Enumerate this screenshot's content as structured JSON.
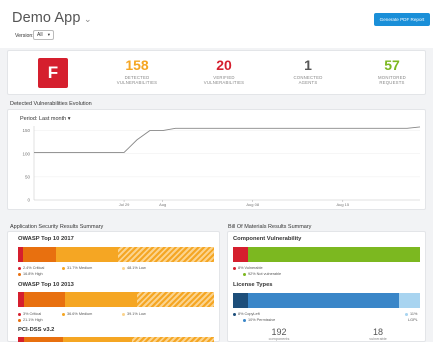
{
  "header": {
    "app_title": "Demo App",
    "generate_button": "Generate PDF Report",
    "version_label": "Version:",
    "version_value": "All"
  },
  "summary": {
    "grade": "F",
    "kpis": [
      {
        "value": "158",
        "label_1": "DETECTED",
        "label_2": "VULNERABILITIES",
        "color": "#f5a623"
      },
      {
        "value": "20",
        "label_1": "VERIFIED",
        "label_2": "VULNERABILITIES",
        "color": "#d51f2e"
      },
      {
        "value": "1",
        "label_1": "CONNECTED",
        "label_2": "AGENTS",
        "color": "#555555"
      },
      {
        "value": "57",
        "label_1": "MONITORED",
        "label_2": "REQUESTS",
        "color": "#7cb820"
      }
    ]
  },
  "evolution": {
    "title": "Detected Vulnerabilities Evolution",
    "period": "Period: Last month"
  },
  "chart_data": {
    "type": "line",
    "title": "",
    "x": [
      "Jul 22",
      "Jul 23",
      "Jul 24",
      "Jul 25",
      "Jul 26",
      "Jul 27",
      "Jul 28",
      "Jul 29",
      "Jul 30",
      "Jul 31",
      "Aug 1",
      "Aug 2",
      "Aug 3",
      "Aug 4",
      "Aug 5",
      "Aug 6",
      "Aug 7",
      "Aug 8",
      "Aug 9",
      "Aug 10",
      "Aug 11",
      "Aug 12",
      "Aug 13",
      "Aug 14",
      "Aug 15",
      "Aug 16",
      "Aug 17",
      "Aug 18",
      "Aug 19",
      "Aug 20",
      "Aug 21"
    ],
    "x_ticks": [
      "Jul 29",
      "Aug",
      "Aug 08",
      "Aug 15"
    ],
    "series": [
      {
        "values": [
          103,
          103,
          103,
          103,
          103,
          103,
          103,
          103,
          130,
          150,
          150,
          155,
          155,
          155,
          155,
          155,
          155,
          155,
          155,
          155,
          155,
          155,
          155,
          155,
          155,
          155,
          155,
          155,
          155,
          155,
          158
        ]
      }
    ],
    "ylim": [
      0,
      160
    ],
    "y_ticks": [
      "0",
      "50",
      "100",
      "150"
    ],
    "grid": true,
    "color": "#888888"
  },
  "app_security": {
    "title": "Application Security Results Summary",
    "groups": [
      {
        "name": "OWASP Top 10 2017",
        "legend": [
          "2.4% Critical",
          "31.7% Medium",
          "48.1% Low",
          "16.8% High"
        ]
      },
      {
        "name": "OWASP Top 10 2013",
        "legend": [
          "3% Critical",
          "36.6% Medium",
          "39.1% Low",
          "21.1% High"
        ]
      },
      {
        "name": "PCI-DSS v3.2",
        "legend": []
      }
    ]
  },
  "bom": {
    "title": "Bill Of Materials Results Summary",
    "component_title": "Component Vulnerability",
    "component_legend": [
      "8% Vulnerable",
      "92% Not vulnerable"
    ],
    "license_title": "License Types",
    "license_legend": [
      "8% CopyLeft",
      "10% Permissive",
      "11%",
      "LGPL"
    ],
    "counts": [
      {
        "value": "192",
        "label": "components"
      },
      {
        "value": "18",
        "label": "vulnerable"
      }
    ]
  },
  "colors": {
    "critical": "#d51f2e",
    "high": "#e8700f",
    "medium": "#f5a623",
    "low": "#fbd38d",
    "not_vulnerable": "#7cb820",
    "copyleft": "#1d4e7a",
    "permissive": "#3a86c8",
    "lgpl": "#a8d4f0"
  }
}
